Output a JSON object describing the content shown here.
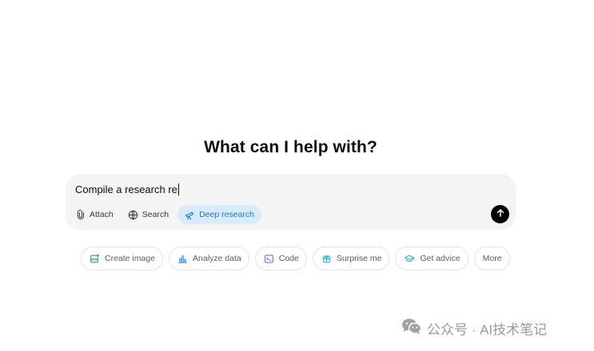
{
  "headline": "What can I help with?",
  "composer": {
    "input_value": "Compile a research re",
    "tools": {
      "attach_label": "Attach",
      "search_label": "Search",
      "deep_research_label": "Deep research"
    },
    "deep_research_active": true
  },
  "suggestions": {
    "create_image": "Create image",
    "analyze_data": "Analyze data",
    "code": "Code",
    "surprise_me": "Surprise me",
    "get_advice": "Get advice",
    "more": "More"
  },
  "icons": {
    "attach": "paperclip-icon",
    "search": "globe-icon",
    "deep_research": "telescope-icon",
    "send": "arrow-up-icon",
    "create_image": "image-icon",
    "analyze_data": "bar-chart-icon",
    "code": "code-terminal-icon",
    "surprise_me": "gift-icon",
    "get_advice": "graduation-cap-icon",
    "watermark": "wechat-icon"
  },
  "colors": {
    "composer_bg": "#f4f4f4",
    "active_tool_bg": "#d8ebfb",
    "active_tool_text": "#1b79d4",
    "create_image_icon": "#38a169",
    "analyze_data_icon": "#3b9de4",
    "code_icon": "#8e5fd6",
    "surprise_me_icon": "#3eb1c8",
    "get_advice_icon": "#3eb1c8"
  },
  "watermark": {
    "text": "公众号 · AI技术笔记"
  }
}
